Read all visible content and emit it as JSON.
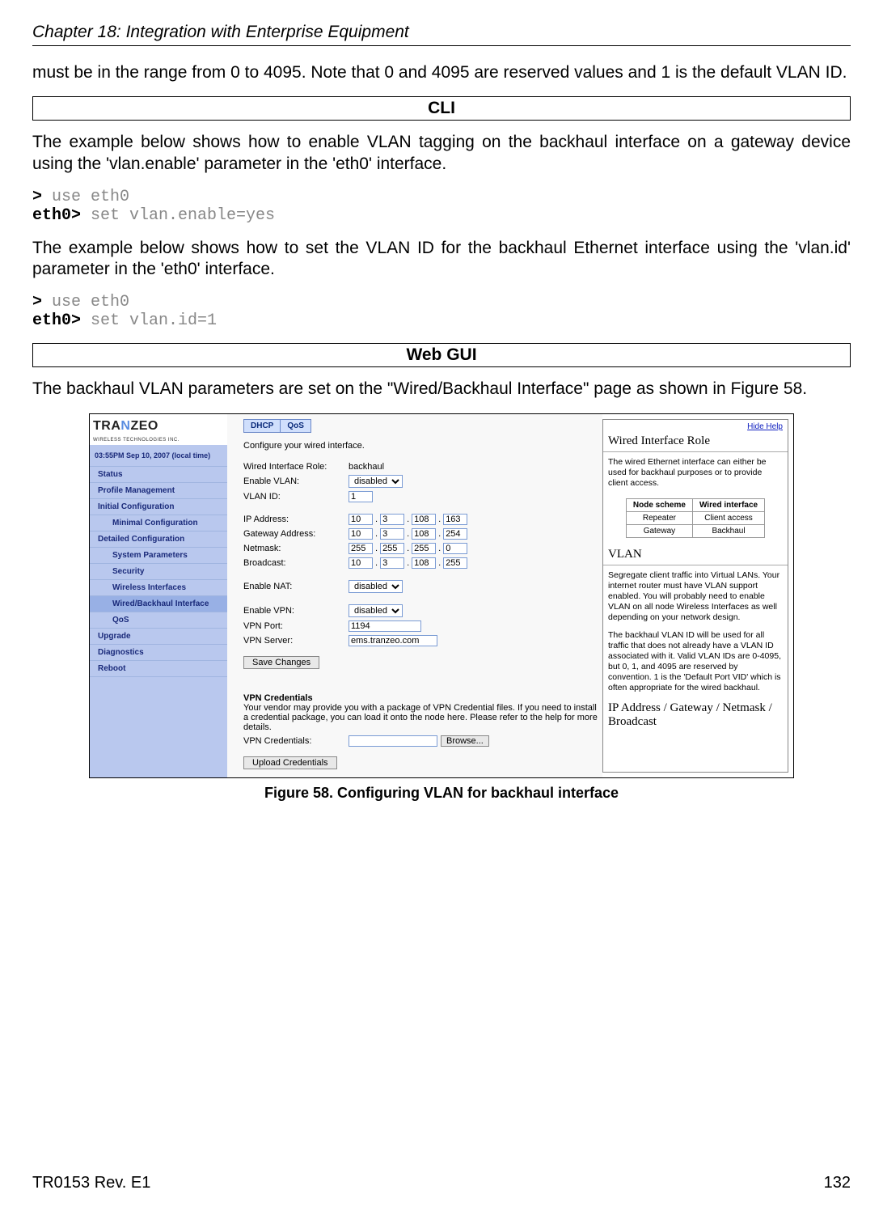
{
  "header": {
    "chapter": "Chapter 18: Integration with Enterprise Equipment"
  },
  "para1": "must be in the range from 0 to 4095. Note that 0 and 4095 are reserved values and 1 is the default VLAN ID.",
  "section_cli": "CLI",
  "para2": "The example below shows how to enable VLAN tagging on the backhaul interface on a gateway device using the 'vlan.enable' parameter in the 'eth0' interface.",
  "cli1": {
    "p1": ">",
    "c1": " use eth0",
    "p2": "eth0>",
    "c2": " set vlan.enable=yes"
  },
  "para3": "The example below shows how to set the VLAN ID for the backhaul Ethernet interface using the 'vlan.id' parameter in the 'eth0' interface.",
  "cli2": {
    "p1": ">",
    "c1": " use eth0",
    "p2": "eth0>",
    "c2": " set vlan.id=1"
  },
  "section_web": "Web GUI",
  "para4": "The backhaul VLAN parameters are set on the \"Wired/Backhaul Interface\" page as shown in Figure 58.",
  "gui": {
    "logo_main1": "TRA",
    "logo_main2": "N",
    "logo_main3": "ZEO",
    "logo_sub": "WIRELESS TECHNOLOGIES INC.",
    "time": "03:55PM Sep 10, 2007 (local time)",
    "nav": {
      "status": "Status",
      "profile": "Profile Management",
      "initial": "Initial Configuration",
      "minimal": "Minimal Configuration",
      "detailed": "Detailed Configuration",
      "sysparam": "System Parameters",
      "security": "Security",
      "wireless": "Wireless Interfaces",
      "wired": "Wired/Backhaul Interface",
      "qos": "QoS",
      "upgrade": "Upgrade",
      "diag": "Diagnostics",
      "reboot": "Reboot"
    },
    "tabs": {
      "dhcp": "DHCP",
      "qos": "QoS"
    },
    "intro": "Configure your wired interface.",
    "labels": {
      "role": "Wired Interface Role:",
      "role_val": "backhaul",
      "enable_vlan": "Enable VLAN:",
      "vlan_id": "VLAN ID:",
      "ip": "IP Address:",
      "gw": "Gateway Address:",
      "nm": "Netmask:",
      "bc": "Broadcast:",
      "nat": "Enable NAT:",
      "vpn": "Enable VPN:",
      "vpnport": "VPN Port:",
      "vpnserver": "VPN Server:"
    },
    "values": {
      "disabled": "disabled",
      "vlan_id": "1",
      "ip": [
        "10",
        "3",
        "108",
        "163"
      ],
      "gw": [
        "10",
        "3",
        "108",
        "254"
      ],
      "nm": [
        "255",
        "255",
        "255",
        "0"
      ],
      "bc": [
        "10",
        "3",
        "108",
        "255"
      ],
      "vpnport": "1194",
      "vpnserver": "ems.tranzeo.com"
    },
    "save_btn": "Save Changes",
    "vpn_cred_h": "VPN Credentials",
    "vpn_cred_p": "Your vendor may provide you with a package of VPN Credential files. If you need to install a credential package, you can load it onto the node here. Please refer to the help for more details.",
    "vpn_cred_lbl": "VPN Credentials:",
    "browse": "Browse...",
    "upload": "Upload Credentials",
    "help": {
      "hide": "Hide Help",
      "h1": "Wired Interface Role",
      "p1": "The wired Ethernet interface can either be used for backhaul purposes or to provide client access.",
      "th1": "Node scheme",
      "th2": "Wired interface",
      "r1c1": "Repeater",
      "r1c2": "Client access",
      "r2c1": "Gateway",
      "r2c2": "Backhaul",
      "h2": "VLAN",
      "p2": "Segregate client traffic into Virtual LANs. Your internet router must have VLAN support enabled. You will probably need to enable VLAN on all node Wireless Interfaces as well depending on your network design.",
      "p3": "The backhaul VLAN ID will be used for all traffic that does not already have a VLAN ID associated with it. Valid VLAN IDs are 0-4095, but 0, 1, and 4095 are reserved by convention. 1 is the 'Default Port VID' which is often appropriate for the wired backhaul.",
      "h3": "IP Address / Gateway / Netmask / Broadcast"
    }
  },
  "caption": "Figure 58. Configuring VLAN for backhaul interface",
  "footer": {
    "left": "TR0153 Rev. E1",
    "right": "132"
  }
}
